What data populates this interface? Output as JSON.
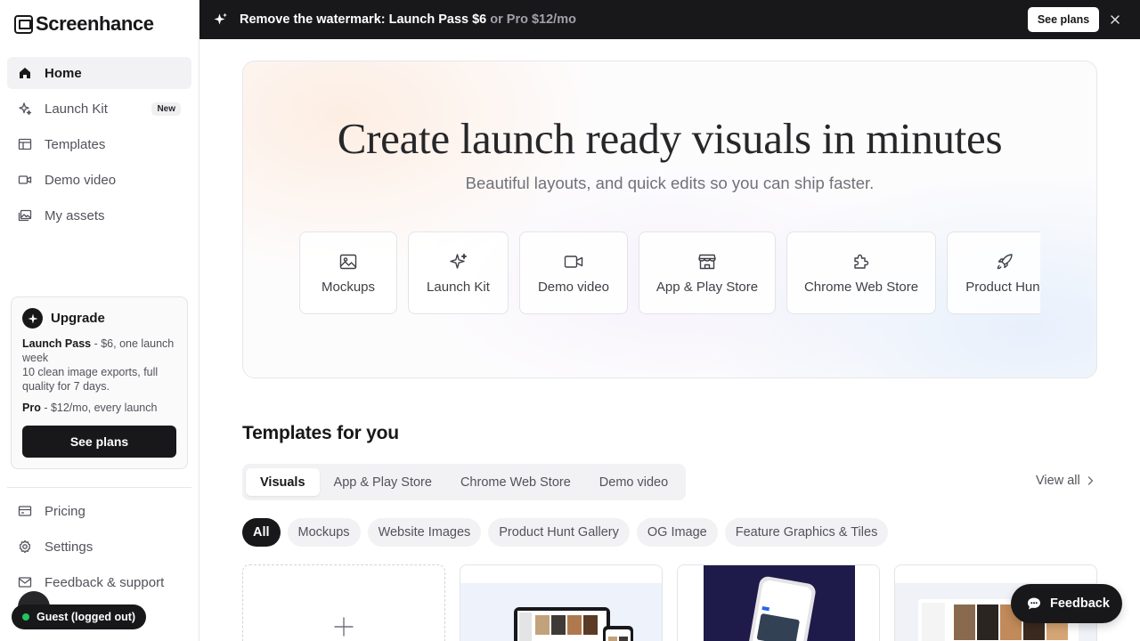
{
  "app": {
    "name": "Screenhance"
  },
  "sidebar": {
    "nav": [
      {
        "label": "Home",
        "icon": "home-icon",
        "active": true
      },
      {
        "label": "Launch Kit",
        "icon": "sparkles-icon",
        "badge": "New"
      },
      {
        "label": "Templates",
        "icon": "templates-icon"
      },
      {
        "label": "Demo video",
        "icon": "video-icon"
      },
      {
        "label": "My assets",
        "icon": "images-icon"
      }
    ],
    "upgrade": {
      "title": "Upgrade",
      "launch_pass_name": "Launch Pass",
      "launch_pass_desc": " - $6, one launch week",
      "launch_pass_detail": "10 clean image exports, full quality for 7 days.",
      "pro_name": "Pro",
      "pro_desc": " - $12/mo, every launch",
      "button": "See plans"
    },
    "bottom_nav": [
      {
        "label": "Pricing",
        "icon": "credit-card-icon"
      },
      {
        "label": "Settings",
        "icon": "gear-icon"
      },
      {
        "label": "Feedback & support",
        "icon": "mail-icon"
      }
    ],
    "guest_label": "Guest (logged out)"
  },
  "banner": {
    "text": "Remove the watermark: Launch Pass $6",
    "text_muted": " or Pro $12/mo",
    "button": "See plans"
  },
  "hero": {
    "title": "Create launch ready visuals in minutes",
    "subtitle": "Beautiful layouts, and quick edits so you can ship faster.",
    "cards": [
      {
        "label": "Mockups",
        "icon": "image-icon"
      },
      {
        "label": "Launch Kit",
        "icon": "sparkles-icon"
      },
      {
        "label": "Demo video",
        "icon": "video-icon"
      },
      {
        "label": "App & Play Store",
        "icon": "store-icon"
      },
      {
        "label": "Chrome Web Store",
        "icon": "puzzle-icon"
      },
      {
        "label": "Product Hunt",
        "icon": "rocket-icon"
      }
    ]
  },
  "templates": {
    "title": "Templates for you",
    "tabs": [
      "Visuals",
      "App & Play Store",
      "Chrome Web Store",
      "Demo video"
    ],
    "active_tab": "Visuals",
    "view_all": "View all",
    "filters": [
      "All",
      "Mockups",
      "Website Images",
      "Product Hunt Gallery",
      "OG Image",
      "Feature Graphics & Tiles"
    ],
    "active_filter": "All"
  },
  "feedback_button": "Feedback"
}
